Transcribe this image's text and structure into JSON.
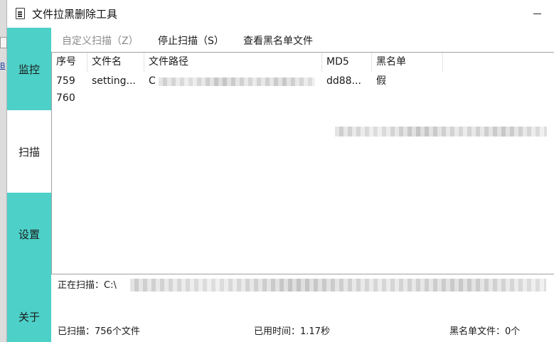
{
  "window": {
    "title": "文件拉黑删除工具"
  },
  "nav": {
    "items": [
      {
        "label": "监控",
        "active": false
      },
      {
        "label": "扫描",
        "active": true
      },
      {
        "label": "设置",
        "active": false
      },
      {
        "label": "关于",
        "active": false
      }
    ],
    "accent_color": "#4dd0c8"
  },
  "toolbar": {
    "custom_scan": "自定义扫描（Z）",
    "stop_scan": "停止扫描（S）",
    "view_blacklist": "查看黑名单文件"
  },
  "table": {
    "columns": [
      "序号",
      "文件名",
      "文件路径",
      "MD5",
      "黑名单"
    ],
    "rows": [
      {
        "index": "759",
        "name": "setting...",
        "path": "C",
        "md5": "dd88...",
        "blacklisted": "假"
      },
      {
        "index": "760",
        "name": "",
        "path": "",
        "md5": "",
        "blacklisted": ""
      }
    ]
  },
  "status": {
    "scanning_label": "正在扫描：C:\\",
    "scanned": "已扫描：756个文件",
    "elapsed": "已用时间：1.17秒",
    "blacklist_count": "黑名单文件：0个"
  }
}
